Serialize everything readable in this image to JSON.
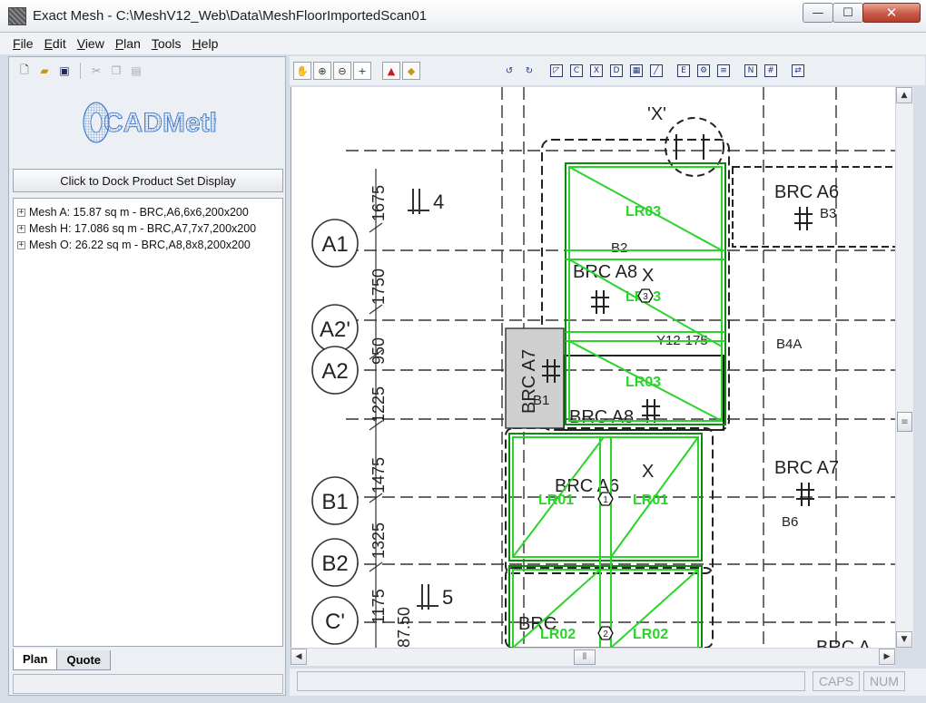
{
  "window": {
    "title": "Exact Mesh - C:\\MeshV12_Web\\Data\\MeshFloorImportedScan01",
    "minimize": "—",
    "maximize": "☐",
    "close": "✕"
  },
  "menu": [
    {
      "label": "File",
      "mnemonic": "F",
      "rest": "ile"
    },
    {
      "label": "Edit",
      "mnemonic": "E",
      "rest": "dit"
    },
    {
      "label": "View",
      "mnemonic": "V",
      "rest": "iew"
    },
    {
      "label": "Plan",
      "mnemonic": "P",
      "rest": "lan"
    },
    {
      "label": "Tools",
      "mnemonic": "T",
      "rest": "ools"
    },
    {
      "label": "Help",
      "mnemonic": "H",
      "rest": "elp"
    }
  ],
  "left_toolbar": {
    "icons": [
      "new-file-icon",
      "open-folder-icon",
      "save-icon",
      "cut-icon",
      "copy-icon",
      "paste-icon"
    ]
  },
  "logo": {
    "text": "CADMethods"
  },
  "dock_button": "Click to Dock Product Set Display",
  "tree": [
    {
      "expander": "+",
      "label": "Mesh A: 15.87 sq m - BRC,A6,6x6,200x200"
    },
    {
      "expander": "+",
      "label": "Mesh H: 17.086 sq m - BRC,A7,7x7,200x200"
    },
    {
      "expander": "+",
      "label": "Mesh O: 26.22 sq m - BRC,A8,8x8,200x200"
    }
  ],
  "tabs": [
    {
      "label": "Plan",
      "active": true
    },
    {
      "label": "Quote",
      "active": false
    }
  ],
  "plan_toolbar": {
    "view_icons": [
      "pan-hand-icon",
      "zoom-in-icon",
      "zoom-out-icon",
      "crosshair-icon",
      "layer-up-icon",
      "layer-toggle-icon"
    ],
    "edit_icons": [
      "rotate-left-icon",
      "rotate-right-icon",
      "draw-mesh-icon",
      "draw-mesh-c-icon",
      "draw-mesh-x-icon",
      "draw-mesh-d-icon",
      "draw-mesh-box-icon",
      "draw-mesh-line-icon",
      "edit-mesh-icon",
      "group-mesh-icon",
      "mesh-list-icon",
      "mesh-number-icon",
      "mesh-grid-icon",
      "mesh-split-icon"
    ]
  },
  "drawing": {
    "grid_rows": [
      {
        "label": "A1",
        "dim": "1675"
      },
      {
        "label": "A2'",
        "dim": "1750"
      },
      {
        "label": "A2",
        "dim": "950"
      },
      {
        "label": "B1",
        "dim": "1225"
      },
      {
        "label": "B2",
        "dim": "1475"
      },
      {
        "label": "C'",
        "dim": "1325"
      }
    ],
    "extra_dims": [
      "1175",
      "87.50"
    ],
    "markers": [
      "4",
      "5"
    ],
    "x_labels": [
      "'X'",
      "X",
      "X"
    ],
    "brc_labels": [
      "BRC A6",
      "BRC A8",
      "BRC A7",
      "BRC A8",
      "BRC A6",
      "BRC A7",
      "BRC",
      "BRC A"
    ],
    "sub_labels": [
      "B3",
      "B2",
      "B1",
      "B6",
      "Y12-175",
      "B4A"
    ],
    "mesh_labels": [
      {
        "text": "LR03"
      },
      {
        "text": "LR03"
      },
      {
        "text": "LR03"
      },
      {
        "text": "LR01"
      },
      {
        "text": "LR01"
      },
      {
        "text": "LR02"
      },
      {
        "text": "LR02"
      }
    ],
    "node_numbers": [
      "3",
      "1",
      "2"
    ]
  },
  "status": {
    "caps": "CAPS",
    "num": "NUM"
  },
  "colors": {
    "mesh_green": "#2bd42b",
    "mesh_dark_green": "#0c8a0c",
    "ink": "#222222"
  }
}
